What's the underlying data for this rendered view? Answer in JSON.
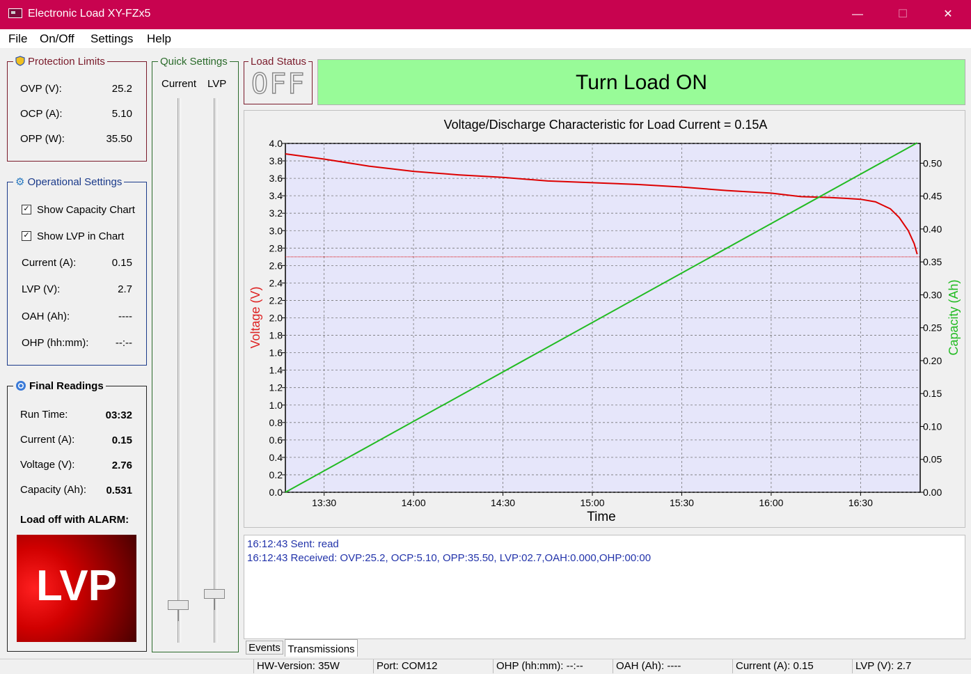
{
  "window": {
    "title": "Electronic Load XY-FZx5",
    "minimize": "—",
    "maximize": "☐",
    "close": "✕"
  },
  "menu": [
    "File",
    "On/Off",
    "Settings",
    "Help"
  ],
  "protection": {
    "title": "Protection Limits",
    "rows": [
      {
        "label": "OVP (V):",
        "value": "25.2"
      },
      {
        "label": "OCP (A):",
        "value": "5.10"
      },
      {
        "label": "OPP (W):",
        "value": "35.50"
      }
    ]
  },
  "operational": {
    "title": "Operational Settings",
    "show_capacity": {
      "label": "Show Capacity Chart",
      "checked": true
    },
    "show_lvp": {
      "label": "Show LVP in Chart",
      "checked": true
    },
    "rows": [
      {
        "label": "Current (A):",
        "value": "0.15"
      },
      {
        "label": "LVP (V):",
        "value": "2.7"
      },
      {
        "label": "OAH (Ah):",
        "value": "----"
      },
      {
        "label": "OHP (hh:mm):",
        "value": "--:--"
      }
    ]
  },
  "final": {
    "title": "Final Readings",
    "rows": [
      {
        "label": "Run Time:",
        "value": "03:32"
      },
      {
        "label": "Current (A):",
        "value": "0.15"
      },
      {
        "label": "Voltage (V):",
        "value": "2.76"
      },
      {
        "label": "Capacity (Ah):",
        "value": "0.531"
      }
    ],
    "alarm_label": "Load off with ALARM:",
    "alarm_text": "LVP"
  },
  "quick": {
    "title": "Quick Settings",
    "current_label": "Current",
    "lvp_label": "LVP",
    "current_level": 0.04,
    "lvp_level": 0.06
  },
  "load_status": {
    "title": "Load Status",
    "display": "OFF",
    "button": "Turn Load ON"
  },
  "chart_data": {
    "type": "line",
    "title": "Voltage/Discharge Characteristic for Load Current = 0.15A",
    "xlabel": "Time",
    "ylabel": "Voltage (V)",
    "y2label": "Capacity (Ah)",
    "xlim": [
      "13:17",
      "16:50"
    ],
    "xticks": [
      "13:30",
      "14:00",
      "14:30",
      "15:00",
      "15:30",
      "16:00",
      "16:30"
    ],
    "ylim": [
      0,
      4.0
    ],
    "yticks": [
      "0.0",
      "0.2",
      "0.4",
      "0.6",
      "0.8",
      "1.0",
      "1.2",
      "1.4",
      "1.6",
      "1.8",
      "2.0",
      "2.2",
      "2.4",
      "2.6",
      "2.8",
      "3.0",
      "3.2",
      "3.4",
      "3.6",
      "3.8",
      "4.0"
    ],
    "y2lim": [
      0,
      0.53
    ],
    "y2ticks": [
      "0.00",
      "0.05",
      "0.10",
      "0.15",
      "0.20",
      "0.25",
      "0.30",
      "0.35",
      "0.40",
      "0.45",
      "0.50"
    ],
    "grid": true,
    "lvp": 2.7,
    "series": [
      {
        "axis": "left",
        "color": "#dd0000",
        "x": [
          "13:17",
          "13:30",
          "13:45",
          "14:00",
          "14:15",
          "14:30",
          "14:45",
          "15:00",
          "15:15",
          "15:30",
          "15:45",
          "16:00",
          "16:10",
          "16:20",
          "16:25",
          "16:30",
          "16:35",
          "16:40",
          "16:43",
          "16:46",
          "16:48",
          "16:49"
        ],
        "y": [
          3.88,
          3.82,
          3.74,
          3.68,
          3.64,
          3.61,
          3.57,
          3.55,
          3.53,
          3.5,
          3.46,
          3.43,
          3.39,
          3.38,
          3.37,
          3.36,
          3.33,
          3.25,
          3.15,
          3.0,
          2.85,
          2.73
        ]
      },
      {
        "axis": "right",
        "color": "#22bb22",
        "x": [
          "13:17",
          "16:49"
        ],
        "y": [
          0.0,
          0.531
        ]
      }
    ]
  },
  "log": {
    "lines": [
      "16:12:43 Sent: read",
      "16:12:43 Received: OVP:25.2, OCP:5.10, OPP:35.50, LVP:02.7,OAH:0.000,OHP:00:00"
    ],
    "tabs": [
      "Events",
      "Transmissions"
    ]
  },
  "statusbar": [
    "HW-Version: 35W",
    "Port:  COM12",
    "OHP (hh:mm):  --:--",
    "OAH (Ah):  ----",
    "Current (A):  0.15",
    "LVP (V):   2.7"
  ],
  "colors": {
    "titlebar": "#c8034f",
    "button_green": "#98fb98",
    "voltage": "#dd0000",
    "capacity": "#22bb22"
  }
}
